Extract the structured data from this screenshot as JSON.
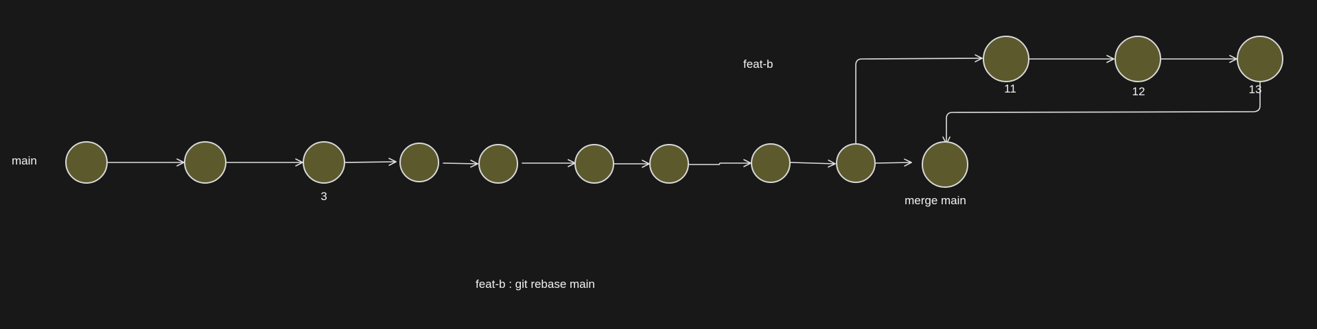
{
  "colors": {
    "background": "#181818",
    "node_fill": "#5c5a2d",
    "node_stroke": "#d9d9d9",
    "edge": "#e0e0e0",
    "text": "#f2f2f2"
  },
  "labels": {
    "main_branch": "main",
    "feat_branch": "feat-b",
    "commit_3": "3",
    "commit_11": "11",
    "commit_12": "12",
    "commit_13": "13",
    "merge": "merge main",
    "command": "feat-b : git rebase main"
  }
}
